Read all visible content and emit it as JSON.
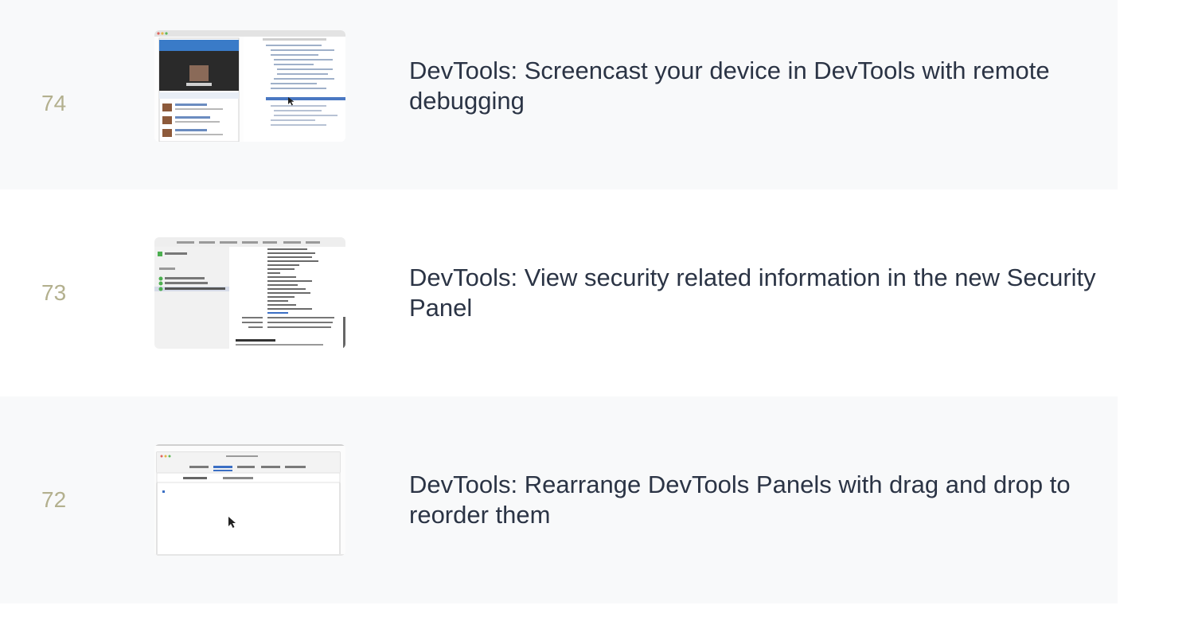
{
  "tips": [
    {
      "number": "74",
      "title": "DevTools: Screencast your device in DevTools with remote debugging",
      "thumbnail": "screencast-device-thumbnail"
    },
    {
      "number": "73",
      "title": "DevTools: View security related information in the new Security Panel",
      "thumbnail": "security-panel-thumbnail"
    },
    {
      "number": "72",
      "title": "DevTools: Rearrange DevTools Panels with drag and drop to reorder them",
      "thumbnail": "rearrange-panels-thumbnail"
    }
  ],
  "colors": {
    "row_shaded": "#f8f9fa",
    "row_plain": "#ffffff",
    "number": "#b3b08e",
    "title": "#2b3445"
  }
}
